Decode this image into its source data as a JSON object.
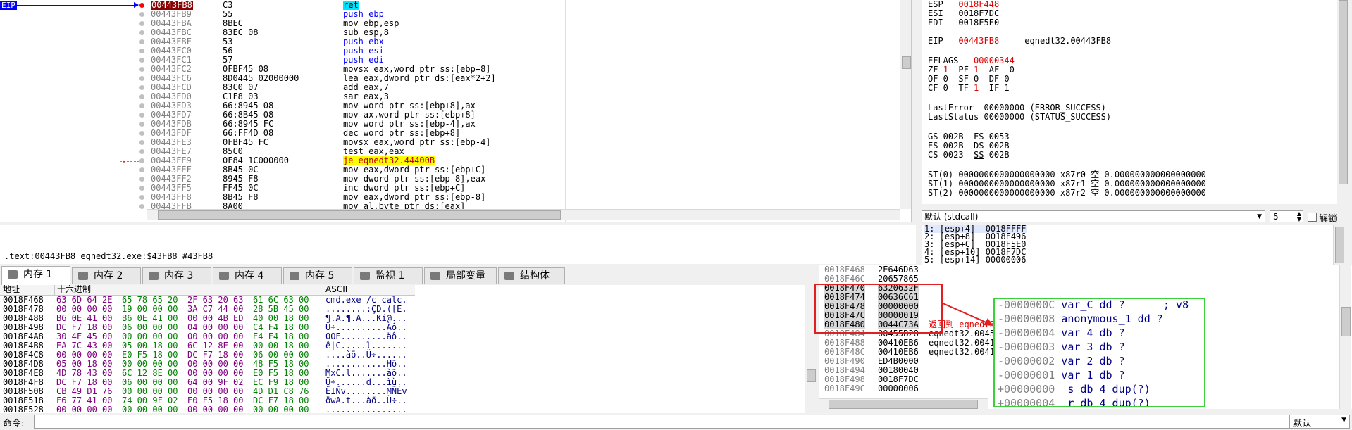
{
  "disasm": {
    "eip_label": "EIP",
    "rows": [
      {
        "addr": "00443FB8",
        "bytes": "C3",
        "instr": "ret",
        "current": true
      },
      {
        "addr": "00443FB9",
        "bytes": "55",
        "instr": "push ebp"
      },
      {
        "addr": "00443FBA",
        "bytes": "8BEC",
        "instr": "mov ebp,esp"
      },
      {
        "addr": "00443FBC",
        "bytes": "83EC 08",
        "instr": "sub esp,8"
      },
      {
        "addr": "00443FBF",
        "bytes": "53",
        "instr": "push ebx"
      },
      {
        "addr": "00443FC0",
        "bytes": "56",
        "instr": "push esi"
      },
      {
        "addr": "00443FC1",
        "bytes": "57",
        "instr": "push edi"
      },
      {
        "addr": "00443FC2",
        "bytes": "0FBF45 08",
        "instr": "movsx eax,word ptr ss:[ebp+8]"
      },
      {
        "addr": "00443FC6",
        "bytes": "8D0445 02000000",
        "instr": "lea eax,dword ptr ds:[eax*2+2]"
      },
      {
        "addr": "00443FCD",
        "bytes": "83C0 07",
        "instr": "add eax,7"
      },
      {
        "addr": "00443FD0",
        "bytes": "C1F8 03",
        "instr": "sar eax,3"
      },
      {
        "addr": "00443FD3",
        "bytes": "66:8945 08",
        "instr": "mov word ptr ss:[ebp+8],ax"
      },
      {
        "addr": "00443FD7",
        "bytes": "66:8B45 08",
        "instr": "mov ax,word ptr ss:[ebp+8]"
      },
      {
        "addr": "00443FDB",
        "bytes": "66:8945 FC",
        "instr": "mov word ptr ss:[ebp-4],ax"
      },
      {
        "addr": "00443FDF",
        "bytes": "66:FF4D 08",
        "instr": "dec word ptr ss:[ebp+8]"
      },
      {
        "addr": "00443FE3",
        "bytes": "0FBF45 FC",
        "instr": "movsx eax,word ptr ss:[ebp-4]"
      },
      {
        "addr": "00443FE7",
        "bytes": "85C0",
        "instr": "test eax,eax"
      },
      {
        "addr": "00443FE9",
        "bytes": "0F84 1C000000",
        "instr": "je eqnedt32.44400B",
        "jump": true
      },
      {
        "addr": "00443FEF",
        "bytes": "8B45 0C",
        "instr": "mov eax,dword ptr ss:[ebp+C]"
      },
      {
        "addr": "00443FF2",
        "bytes": "8945 F8",
        "instr": "mov dword ptr ss:[ebp-8],eax"
      },
      {
        "addr": "00443FF5",
        "bytes": "FF45 0C",
        "instr": "inc dword ptr ss:[ebp+C]"
      },
      {
        "addr": "00443FF8",
        "bytes": "8B45 F8",
        "instr": "mov eax,dword ptr ss:[ebp-8]"
      },
      {
        "addr": "00443FFB",
        "bytes": "8A00",
        "instr": "mov al,byte ptr ds:[eax]"
      }
    ]
  },
  "info_line": ".text:00443FB8 eqnedt32.exe:$43FB8 #43FB8",
  "registers": {
    "esp_name": "ESP",
    "esp_val": "0018F448",
    "esi_name": "ESI",
    "esi_val": "0018F7DC",
    "edi_name": "EDI",
    "edi_val": "0018F5E0",
    "eip_name": "EIP",
    "eip_val": "00443FB8",
    "eip_sym": "eqnedt32.00443FB8",
    "eflags_name": "EFLAGS",
    "eflags_val": "00000344",
    "flags_line1_a": "ZF",
    "flags_line1_b": "1",
    "flags_line1_c": "PF",
    "flags_line1_d": "1",
    "flags_line1_e": "AF  0",
    "flags_line2": "OF 0  SF 0  DF 0",
    "flags_line3_a": "CF 0  ",
    "flags_line3_b": "TF",
    "flags_line3_c": "1",
    "flags_line3_d": "IF 1",
    "lasterror": "LastError  00000000 (ERROR_SUCCESS)",
    "laststatus": "LastStatus 00000000 (STATUS_SUCCESS)",
    "seg1": "GS 002B  FS 0053",
    "seg2": "ES 002B  DS 002B",
    "seg3a": "CS 0023  ",
    "seg3b": "SS",
    "seg3c": " 002B",
    "st0": "ST(0) 0000000000000000000 x87r0 空 0.000000000000000000",
    "st1": "ST(1) 0000000000000000000 x87r1 空 0.000000000000000000",
    "st2": "ST(2) 0000000000000000000 x87r2 空 0.000000000000000000"
  },
  "callconv": {
    "value": "默认 (stdcall)",
    "count": "5",
    "unlock_label": "解锁"
  },
  "callstack": [
    "1: [esp+4]  0018FFFF",
    "2: [esp+8]  0018F496",
    "3: [esp+C]  0018F5E0",
    "4: [esp+10] 0018F7DC",
    "5: [esp+14] 00000006"
  ],
  "tabs": [
    {
      "label": "内存 1",
      "active": true
    },
    {
      "label": "内存 2"
    },
    {
      "label": "内存 3"
    },
    {
      "label": "内存 4"
    },
    {
      "label": "内存 5"
    },
    {
      "label": "监视 1"
    },
    {
      "label": "局部变量"
    },
    {
      "label": "结构体"
    }
  ],
  "dump": {
    "hdr_addr": "地址",
    "hdr_hex": "十六进制",
    "hdr_ascii": "ASCII",
    "rows": [
      {
        "addr": "0018F468",
        "h1": "63 6D 64 2E",
        "h2": "65 78 65 20",
        "h3": "2F 63 20 63",
        "h4": "61 6C 63 00",
        "ascii": "cmd.exe /c calc."
      },
      {
        "addr": "0018F478",
        "h1": "00 00 00 00",
        "h2": "19 00 00 00",
        "h3": "3A C7 44 00",
        "h4": "28 5B 45 00",
        "ascii": "........:ÇD.([E."
      },
      {
        "addr": "0018F488",
        "h1": "B6 0E 41 00",
        "h2": "B6 0E 41 00",
        "h3": "00 00 4B ED",
        "h4": "40 00 18 00",
        "ascii": "¶.A.¶.A...Kí@..."
      },
      {
        "addr": "0018F498",
        "h1": "DC F7 18 00",
        "h2": "06 00 00 00",
        "h3": "04 00 00 00",
        "h4": "C4 F4 18 00",
        "ascii": "Ü÷..........Äô.."
      },
      {
        "addr": "0018F4A8",
        "h1": "30 4F 45 00",
        "h2": "00 00 00 00",
        "h3": "00 00 00 00",
        "h4": "E4 F4 18 00",
        "ascii": "0OE.........äô.."
      },
      {
        "addr": "0018F4B8",
        "h1": "EA 7C 43 00",
        "h2": "05 00 18 00",
        "h3": "6C 12 8E 00",
        "h4": "00 00 18 00",
        "ascii": "ê|C.....l......."
      },
      {
        "addr": "0018F4C8",
        "h1": "00 00 00 00",
        "h2": "E0 F5 18 00",
        "h3": "DC F7 18 00",
        "h4": "06 00 00 00",
        "ascii": "....àõ..Ü÷......"
      },
      {
        "addr": "0018F4D8",
        "h1": "05 00 18 00",
        "h2": "00 00 00 00",
        "h3": "00 00 00 00",
        "h4": "48 F5 18 00",
        "ascii": "............Hõ.."
      },
      {
        "addr": "0018F4E8",
        "h1": "4D 78 43 00",
        "h2": "6C 12 8E 00",
        "h3": "00 00 00 00",
        "h4": "E0 F5 18 00",
        "ascii": "MxC.l.......àõ.."
      },
      {
        "addr": "0018F4F8",
        "h1": "DC F7 18 00",
        "h2": "06 00 00 00",
        "h3": "64 00 9F 02",
        "h4": "EC F9 18 00",
        "ascii": "Ü÷......d...ìù.."
      },
      {
        "addr": "0018F508",
        "h1": "CB 49 D1 76",
        "h2": "00 00 00 00",
        "h3": "00 00 00 00",
        "h4": "4D D1 C8 76",
        "ascii": "ËIÑv........MÑÈv"
      },
      {
        "addr": "0018F518",
        "h1": "F6 77 41 00",
        "h2": "74 00 9F 02",
        "h3": "E0 F5 18 00",
        "h4": "DC F7 18 00",
        "ascii": "öwA.t...àõ..Ü÷.."
      },
      {
        "addr": "0018F528",
        "h1": "00 00 00 00",
        "h2": "00 00 00 00",
        "h3": "00 00 00 00",
        "h4": "00 00 00 00",
        "ascii": "................"
      }
    ]
  },
  "stack": {
    "rows": [
      {
        "addr": "0018F468",
        "val": "2E646D63",
        "cmt": ""
      },
      {
        "addr": "0018F46C",
        "val": "20657865",
        "cmt": ""
      },
      {
        "addr": "0018F470",
        "val": "6320632F",
        "cmt": ""
      },
      {
        "addr": "0018F474",
        "val": "00636C61",
        "cmt": ""
      },
      {
        "addr": "0018F478",
        "val": "00000000",
        "cmt": ""
      },
      {
        "addr": "0018F47C",
        "val": "00000019",
        "cmt": ""
      },
      {
        "addr": "0018F480",
        "val": "0044C73A",
        "cmt": "返回到 eqnedt32.0044C73A"
      },
      {
        "addr": "0018F484",
        "val": "00455B28",
        "cmt": "eqnedt32.00455B28"
      },
      {
        "addr": "0018F488",
        "val": "00410EB6",
        "cmt": "eqnedt32.00410EB6"
      },
      {
        "addr": "0018F48C",
        "val": "00410EB6",
        "cmt": "eqnedt32.00410EB6"
      },
      {
        "addr": "0018F490",
        "val": "ED4B0000",
        "cmt": ""
      },
      {
        "addr": "0018F494",
        "val": "00180040",
        "cmt": ""
      },
      {
        "addr": "0018F498",
        "val": "0018F7DC",
        "cmt": ""
      },
      {
        "addr": "0018F49C",
        "val": "00000006",
        "cmt": ""
      }
    ]
  },
  "ida": {
    "lines": [
      {
        "off": "-0000000C",
        "txt": " var_C dd ?",
        "cmt": "; v8"
      },
      {
        "off": "-00000008",
        "txt": " anonymous_1 dd ?",
        "cmt": ""
      },
      {
        "off": "-00000004",
        "txt": " var_4 db ?",
        "cmt": ""
      },
      {
        "off": "-00000003",
        "txt": " var_3 db ?",
        "cmt": ""
      },
      {
        "off": "-00000002",
        "txt": " var_2 db ?",
        "cmt": ""
      },
      {
        "off": "-00000001",
        "txt": " var_1 db ?",
        "cmt": ""
      },
      {
        "off": "+00000000",
        "txt": "  s db 4 dup(?)",
        "cmt": ""
      },
      {
        "off": "+00000004",
        "txt": "  r db 4 dup(?)",
        "cmt": ""
      }
    ]
  },
  "cmdbar": {
    "label": "命令:",
    "mode": "默认"
  },
  "colors": {
    "accent_red": "#e00000",
    "highlight_box": "#e02020",
    "ida_border": "#3cd03c",
    "eip_blue": "#0000ff"
  }
}
